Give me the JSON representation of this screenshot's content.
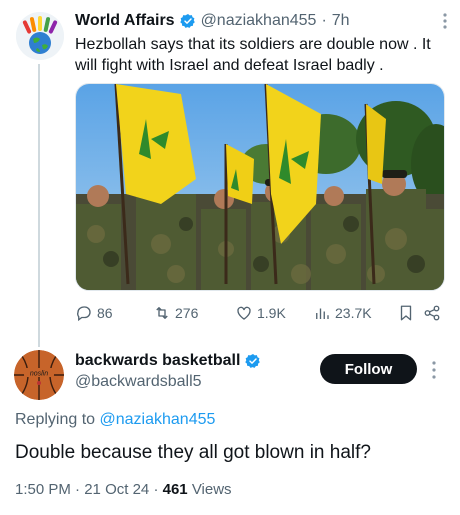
{
  "tweet1": {
    "name": "World Affairs",
    "handle": "@naziakhan455",
    "separator": "·",
    "time": "7h",
    "text": "Hezbollah says that its soldiers are double now . It will fight with Israel and defeat Israel badly .",
    "actions": {
      "replies": "86",
      "retweets": "276",
      "likes": "1.9K",
      "views": "23.7K"
    }
  },
  "tweet2": {
    "name": "backwards basketball",
    "handle": "@backwardsball5",
    "follow_label": "Follow",
    "replying_prefix": "Replying to",
    "replying_handle": "@naziakhan455",
    "text": "Double because they all got blown in half?",
    "time": "1:50 PM",
    "separator": "·",
    "date": "21 Oct 24",
    "views_count": "461",
    "views_label": "Views"
  },
  "colors": {
    "accent": "#1d9bf0",
    "text": "#0f1419",
    "secondary": "#536471",
    "flag_yellow": "#f2d31b",
    "flag_green": "#2f8a2b"
  },
  "icons": [
    "verified-icon",
    "reply-icon",
    "retweet-icon",
    "like-icon",
    "views-icon",
    "bookmark-icon",
    "share-icon",
    "more-icon"
  ]
}
